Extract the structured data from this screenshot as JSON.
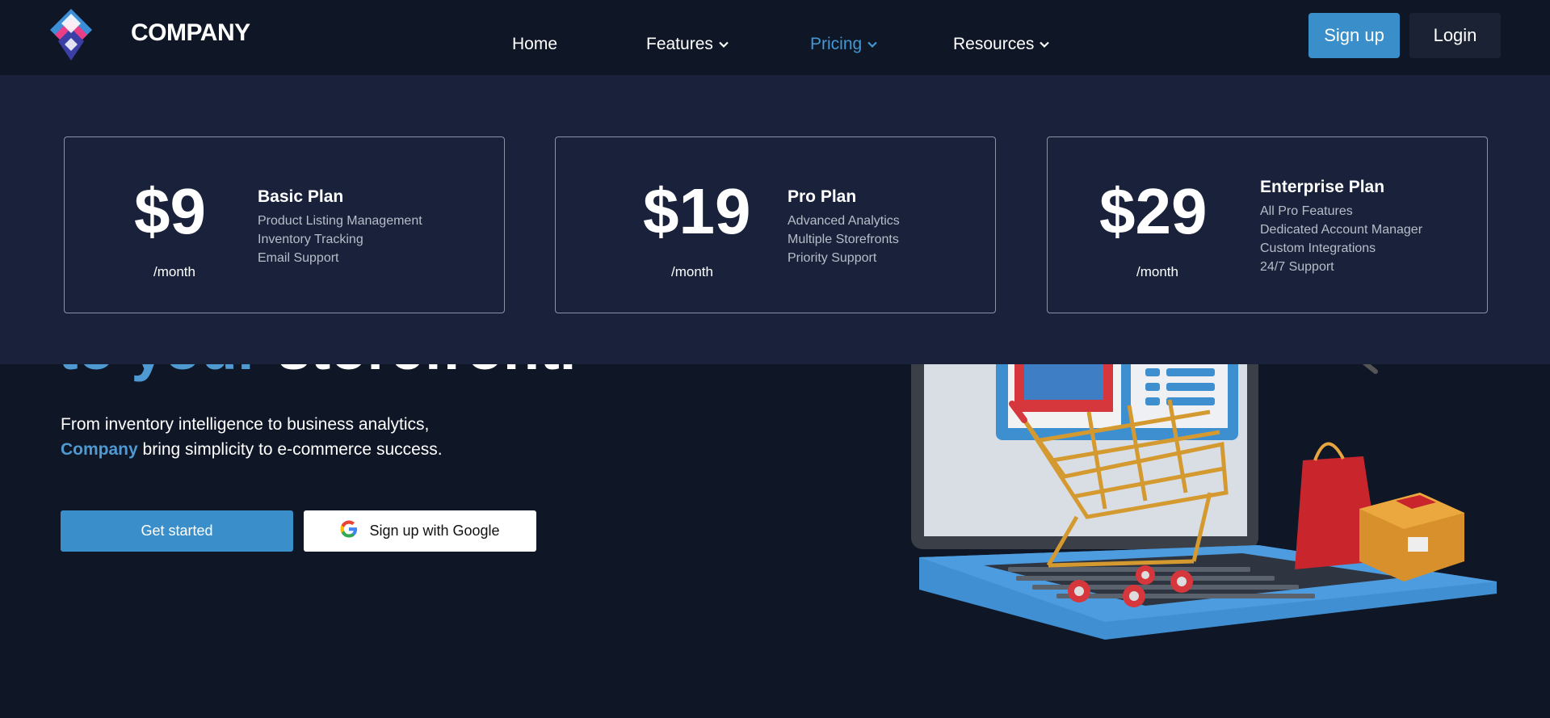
{
  "brand": {
    "name": "COMPANY"
  },
  "nav": {
    "links": [
      {
        "label": "Home",
        "has_dropdown": false
      },
      {
        "label": "Features",
        "has_dropdown": true
      },
      {
        "label": "Pricing",
        "has_dropdown": true,
        "active": true
      },
      {
        "label": "Resources",
        "has_dropdown": true
      }
    ],
    "signup_label": "Sign up",
    "login_label": "Login"
  },
  "pricing": {
    "plans": [
      {
        "price": "$9",
        "period": "/month",
        "name": "Basic Plan",
        "features": [
          "Product Listing Management",
          "Inventory Tracking",
          "Email Support"
        ]
      },
      {
        "price": "$19",
        "period": "/month",
        "name": "Pro Plan",
        "features": [
          "Advanced Analytics",
          "Multiple Storefronts",
          "Priority Support"
        ]
      },
      {
        "price": "$29",
        "period": "/month",
        "name": "Enterprise Plan",
        "features": [
          "All Pro Features",
          "Dedicated Account Manager",
          "Custom Integrations",
          "24/7 Support"
        ]
      }
    ]
  },
  "hero": {
    "heading_accent": "to your",
    "heading_rest": "storefront.",
    "subtitle_line1": "From inventory intelligence to business analytics,",
    "subtitle_accent": "Company",
    "subtitle_line2": "bring simplicity to e-commerce success.",
    "cta_primary": "Get started",
    "cta_google": "Sign up with Google"
  },
  "colors": {
    "background": "#0f1626",
    "dropdown_bg": "#19223a",
    "accent": "#3a8fcb",
    "accent_text": "#4f9ad3"
  }
}
